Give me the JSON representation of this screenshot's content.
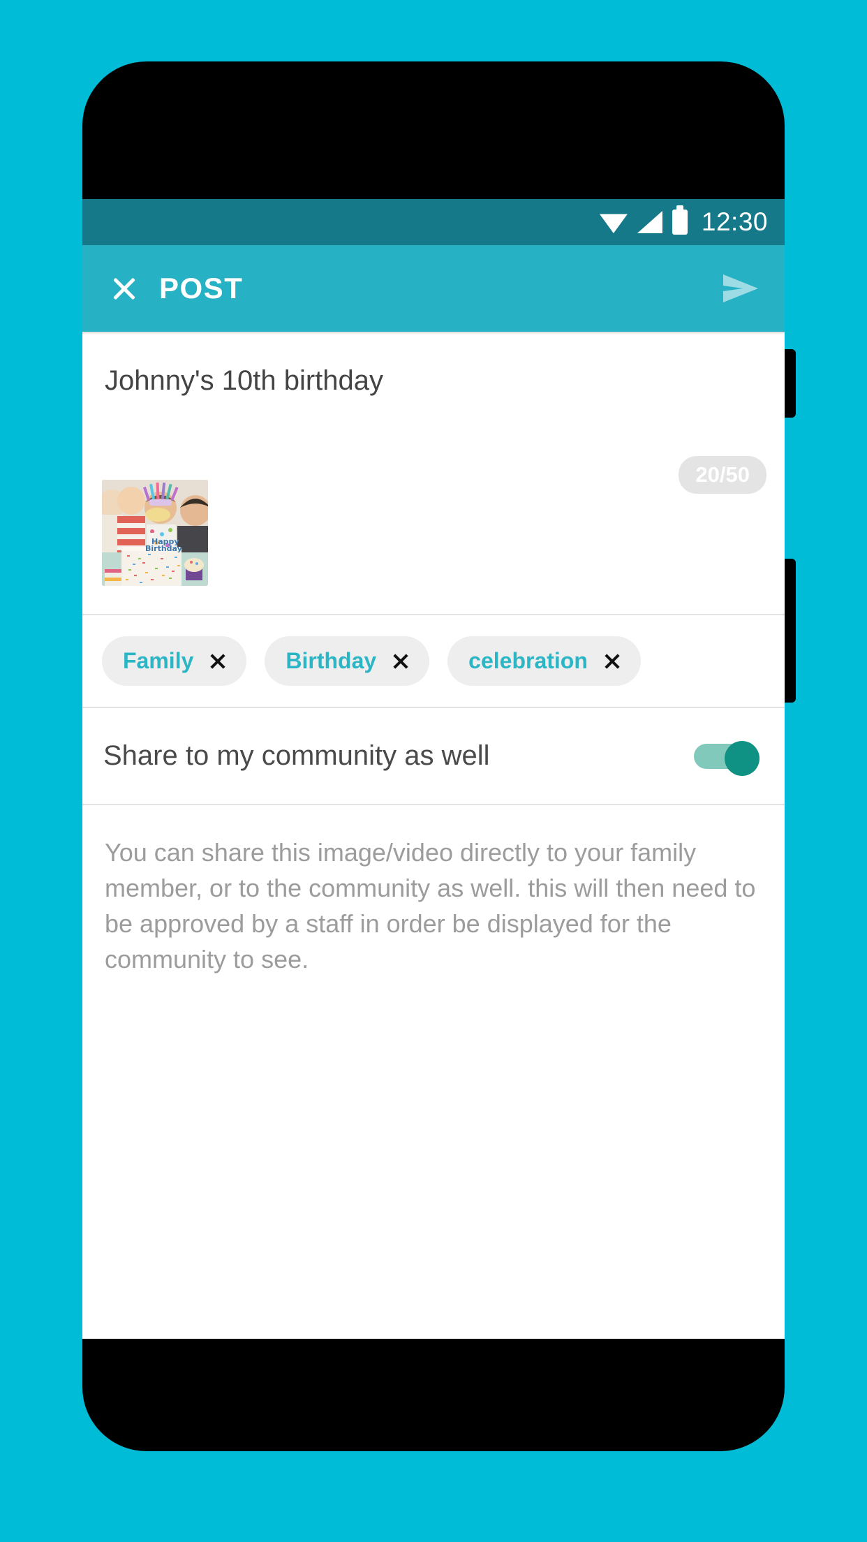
{
  "theme": {
    "background": "#00bcd6",
    "status_bar": "#16798a",
    "app_bar": "#26b2c4",
    "accent": "#2cb5c4",
    "toggle_on_thumb": "#0f9183",
    "toggle_on_track": "#80c9bb"
  },
  "status_bar": {
    "time": "12:30",
    "icons": [
      "wifi-icon",
      "signal-icon",
      "battery-icon"
    ]
  },
  "app_bar": {
    "close_icon": "close-icon",
    "title": "POST",
    "send_icon": "send-icon"
  },
  "compose": {
    "text": "Johnny's 10th birthday",
    "char_counter": "20/50",
    "attachment": {
      "type": "photo-thumbnail",
      "alt": "children at a birthday party with a sprinkled cake"
    }
  },
  "tags": [
    {
      "label": "Family",
      "remove_icon": "close-icon"
    },
    {
      "label": "Birthday",
      "remove_icon": "close-icon"
    },
    {
      "label": "celebration",
      "remove_icon": "close-icon"
    }
  ],
  "share_setting": {
    "label": "Share to my community as well",
    "toggle_state": "on"
  },
  "description": {
    "text": "You can share this image/video directly to your family member, or to the community as well. this will then need to be approved by a staff in order be displayed for the community to see."
  }
}
